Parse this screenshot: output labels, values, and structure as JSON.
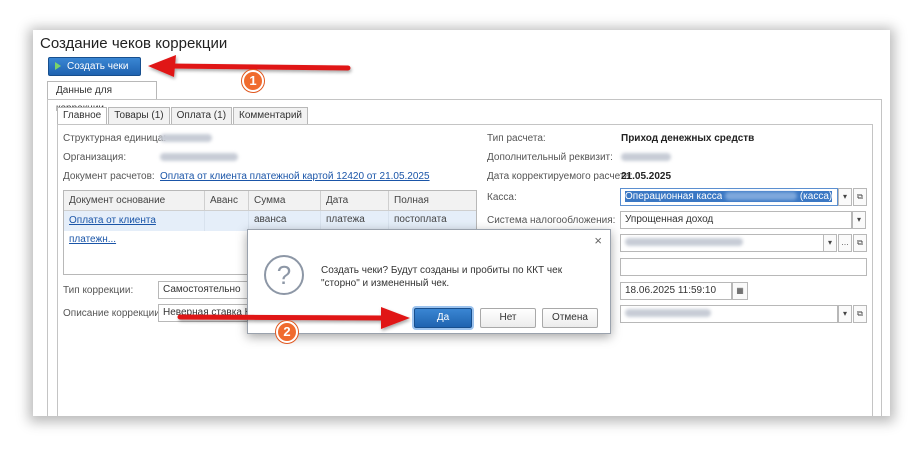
{
  "page": {
    "title": "Создание чеков коррекции"
  },
  "toolbar": {
    "create_label": "Создать чеки"
  },
  "outer_tab": {
    "label": "Данные для коррекции"
  },
  "tabs": [
    "Главное",
    "Товары (1)",
    "Оплата (1)",
    "Комментарий"
  ],
  "left": {
    "unit_label": "Структурная единица:",
    "org_label": "Организация:",
    "doc_label": "Документ расчетов:",
    "doc_link": "Оплата от клиента платежной картой 12420 от 21.05.2025",
    "corr_type_label": "Тип коррекции:",
    "corr_type_value": "Самостоятельно",
    "corr_desc_label": "Описание коррекции:",
    "corr_desc_value": "Неверная ставка НД"
  },
  "table": {
    "headers": [
      "Документ основание",
      "Аванс",
      "Сумма аванса",
      "Дата платежа",
      "Полная постоплата"
    ],
    "row": [
      "Оплата от клиента платежн...",
      "",
      "",
      "",
      ""
    ]
  },
  "right": {
    "calc_type_label": "Тип расчета:",
    "calc_type_value": "Приход денежных средств",
    "extra_label": "Дополнительный реквизит:",
    "date_label": "Дата корректируемого расчета:",
    "date_value": "21.05.2025",
    "cash_label": "Касса:",
    "cash_value": "Операционная касса",
    "cash_suffix": "(касса)",
    "tax_label": "Система налогообложения:",
    "tax_value": "Упрощенная доход",
    "datetime_value": "18.06.2025 11:59:10"
  },
  "dialog": {
    "question_icon": "?",
    "text": "Создать чеки? Будут созданы и пробиты по ККТ чек \"сторно\" и измененный чек.",
    "yes": "Да",
    "no": "Нет",
    "cancel": "Отмена",
    "close": "×"
  },
  "annotations": {
    "step1": "1",
    "step2": "2"
  },
  "colors": {
    "accent": "#1f63b0",
    "arrow": "#e01919",
    "badge": "#f06b2e"
  }
}
